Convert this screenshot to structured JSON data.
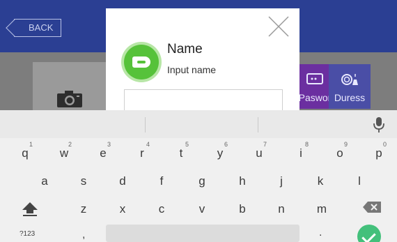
{
  "appbar": {
    "back_label": "BACK"
  },
  "tiles": {
    "password_label": "Paswor",
    "duress_label": "Duress"
  },
  "dialog": {
    "title": "Name",
    "subtitle": "Input name",
    "input_value": ""
  },
  "keyboard": {
    "row1": [
      "q",
      "w",
      "e",
      "r",
      "t",
      "y",
      "u",
      "i",
      "o",
      "p"
    ],
    "row1_hints": [
      "1",
      "2",
      "3",
      "4",
      "5",
      "6",
      "7",
      "8",
      "9",
      "0"
    ],
    "row2": [
      "a",
      "s",
      "d",
      "f",
      "g",
      "h",
      "j",
      "k",
      "l"
    ],
    "row3": [
      "z",
      "x",
      "c",
      "v",
      "b",
      "n",
      "m"
    ],
    "symbols_label": "?123",
    "comma": ",",
    "period": "."
  },
  "colors": {
    "appbar": "#2b3f93",
    "dialog_accent": "#56c23a",
    "enter": "#43c07b",
    "password_tile": "#6b2fa0",
    "duress_tile": "#4a4ea6"
  }
}
